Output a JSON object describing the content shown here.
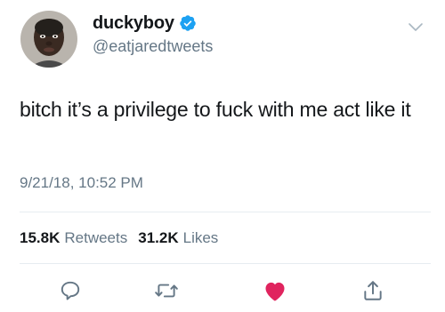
{
  "user": {
    "display_name": "duckyboy",
    "handle": "@eatjaredtweets",
    "verified": true,
    "avatar_icon": "profile-photo"
  },
  "tweet": {
    "text": "bitch it’s a privilege to fuck with me act like it",
    "timestamp": "9/21/18, 10:52 PM"
  },
  "stats": {
    "retweets_count": "15.8K",
    "retweets_label": "Retweets",
    "likes_count": "31.2K",
    "likes_label": "Likes"
  },
  "actions": [
    {
      "name": "reply",
      "icon": "reply-icon"
    },
    {
      "name": "retweet",
      "icon": "retweet-icon"
    },
    {
      "name": "like",
      "icon": "heart-icon",
      "active": true
    },
    {
      "name": "share",
      "icon": "share-icon"
    }
  ],
  "colors": {
    "verified_blue": "#1da1f2",
    "like_red": "#e0245e",
    "secondary_text": "#657786",
    "primary_text": "#14171a",
    "divider": "#e6ecf0"
  }
}
